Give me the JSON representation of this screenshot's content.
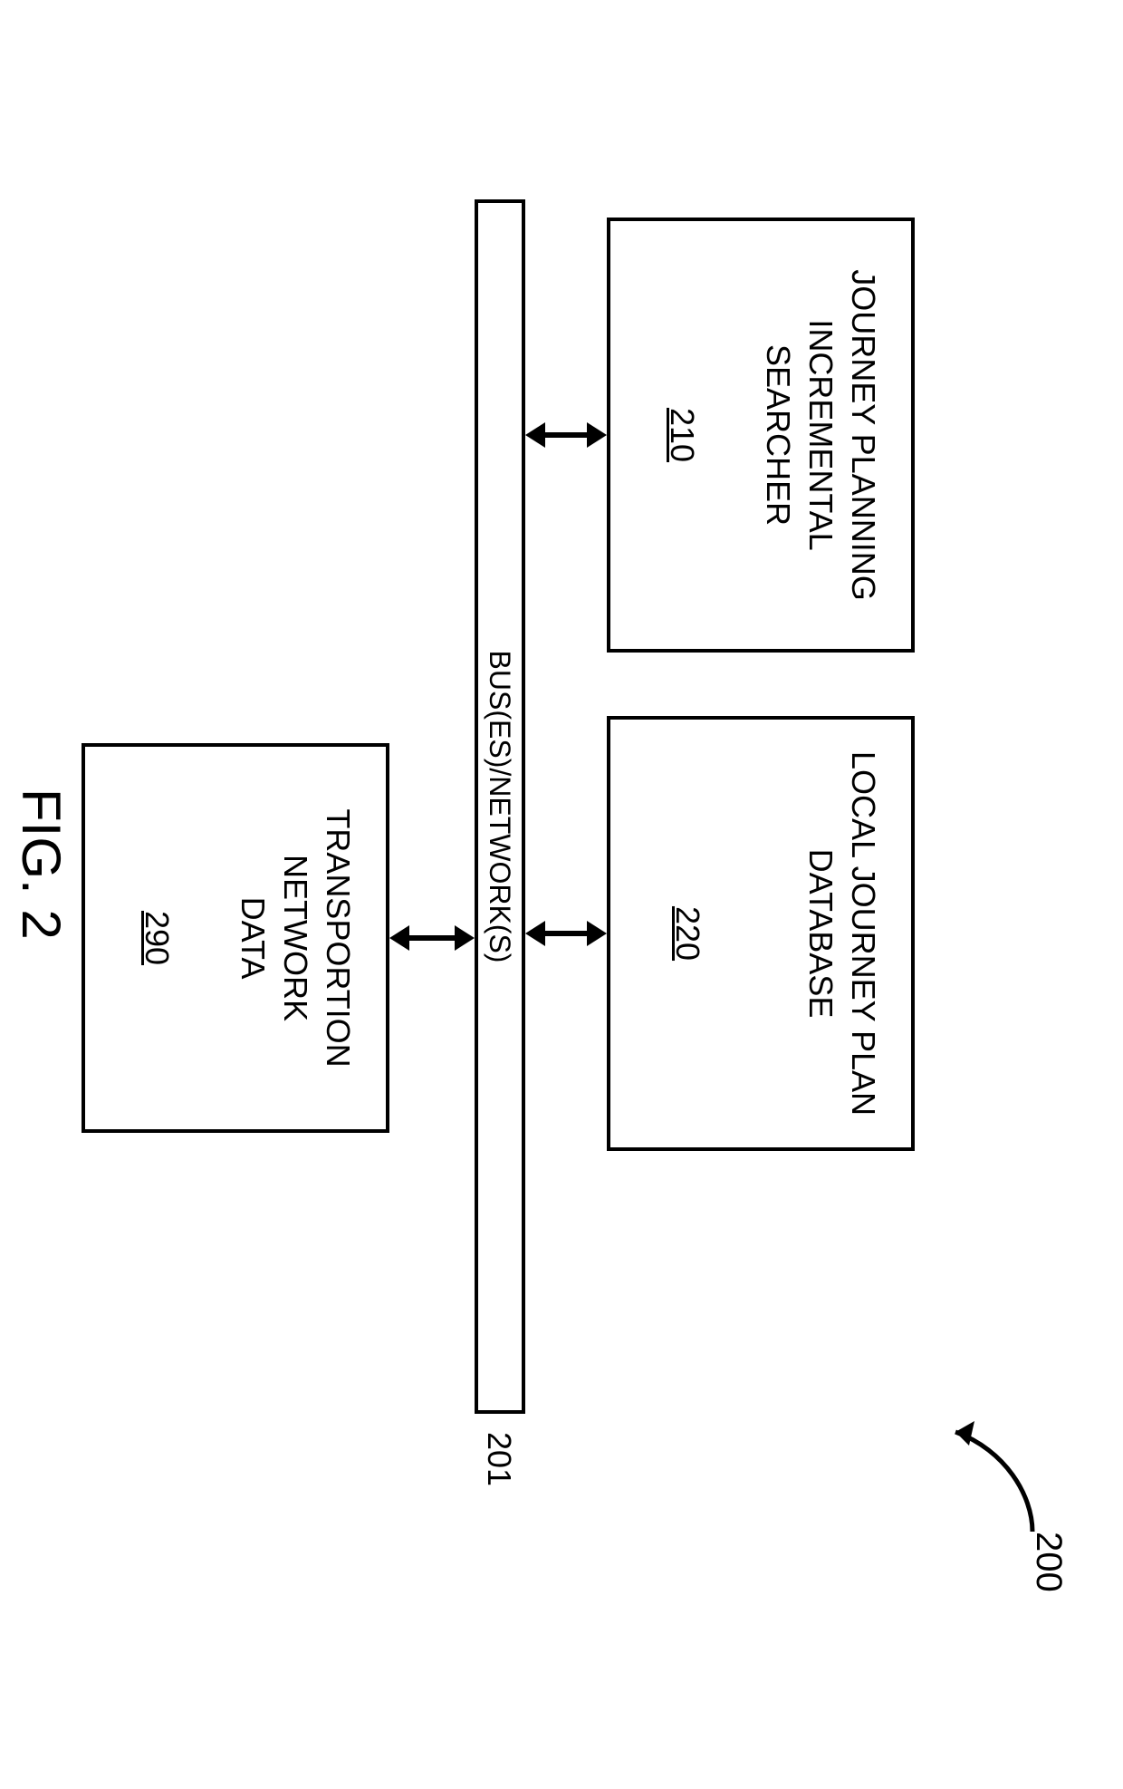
{
  "figure_ref": "200",
  "bus": {
    "label": "BUS(ES)/NETWORK(S)",
    "ref": "201"
  },
  "blocks": {
    "searcher": {
      "line1": "JOURNEY PLANNING",
      "line2": "INCREMENTAL",
      "line3": "SEARCHER",
      "ref": "210"
    },
    "localdb": {
      "line1": "LOCAL JOURNEY PLAN",
      "line2": "DATABASE",
      "ref": "220"
    },
    "transport": {
      "line1": "TRANSPORTION",
      "line2": "NETWORK",
      "line3": "DATA",
      "ref": "290"
    }
  },
  "caption": "FIG. 2"
}
